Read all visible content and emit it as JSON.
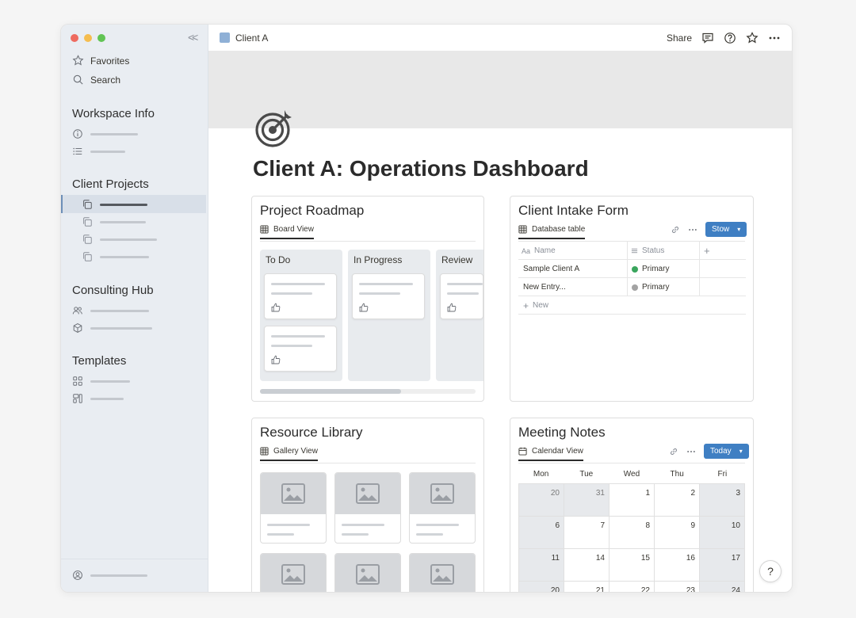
{
  "breadcrumb": {
    "title": "Client A"
  },
  "topbar": {
    "share_label": "Share"
  },
  "sidebar": {
    "favorites_label": "Favorites",
    "search_label": "Search",
    "sections": {
      "workspace": "Workspace Info",
      "client_projects": "Client Projects",
      "consulting": "Consulting Hub",
      "templates": "Templates"
    }
  },
  "page": {
    "title": "Client A: Operations Dashboard"
  },
  "roadmap": {
    "title": "Project Roadmap",
    "view_label": "Board View",
    "columns": [
      "To Do",
      "In Progress",
      "Review"
    ]
  },
  "intake": {
    "title": "Client Intake Form",
    "view_label": "Database table",
    "button_label": "Stow",
    "headers": {
      "name": "Name",
      "status": "Status"
    },
    "rows": [
      {
        "name": "Sample Client A",
        "status": "Primary",
        "color": "#3aa55d"
      },
      {
        "name": "New Entry...",
        "status": "Primary",
        "color": "#a3a3a3"
      }
    ],
    "new_label": "New"
  },
  "library": {
    "title": "Resource Library",
    "view_label": "Gallery View"
  },
  "meeting": {
    "title": "Meeting Notes",
    "view_label": "Calendar View",
    "button_label": "Today",
    "days": [
      "Mon",
      "Tue",
      "Wed",
      "Thu",
      "Fri"
    ],
    "weeks": [
      [
        "20",
        "31",
        "1",
        "2",
        "3"
      ],
      [
        "6",
        "7",
        "8",
        "9",
        "10"
      ],
      [
        "11",
        "14",
        "15",
        "16",
        "17"
      ],
      [
        "20",
        "21",
        "22",
        "23",
        "24"
      ]
    ]
  },
  "help_label": "?",
  "colors": {
    "accent": "#3f7fc3",
    "sidebar_bg": "#e9edf2"
  }
}
